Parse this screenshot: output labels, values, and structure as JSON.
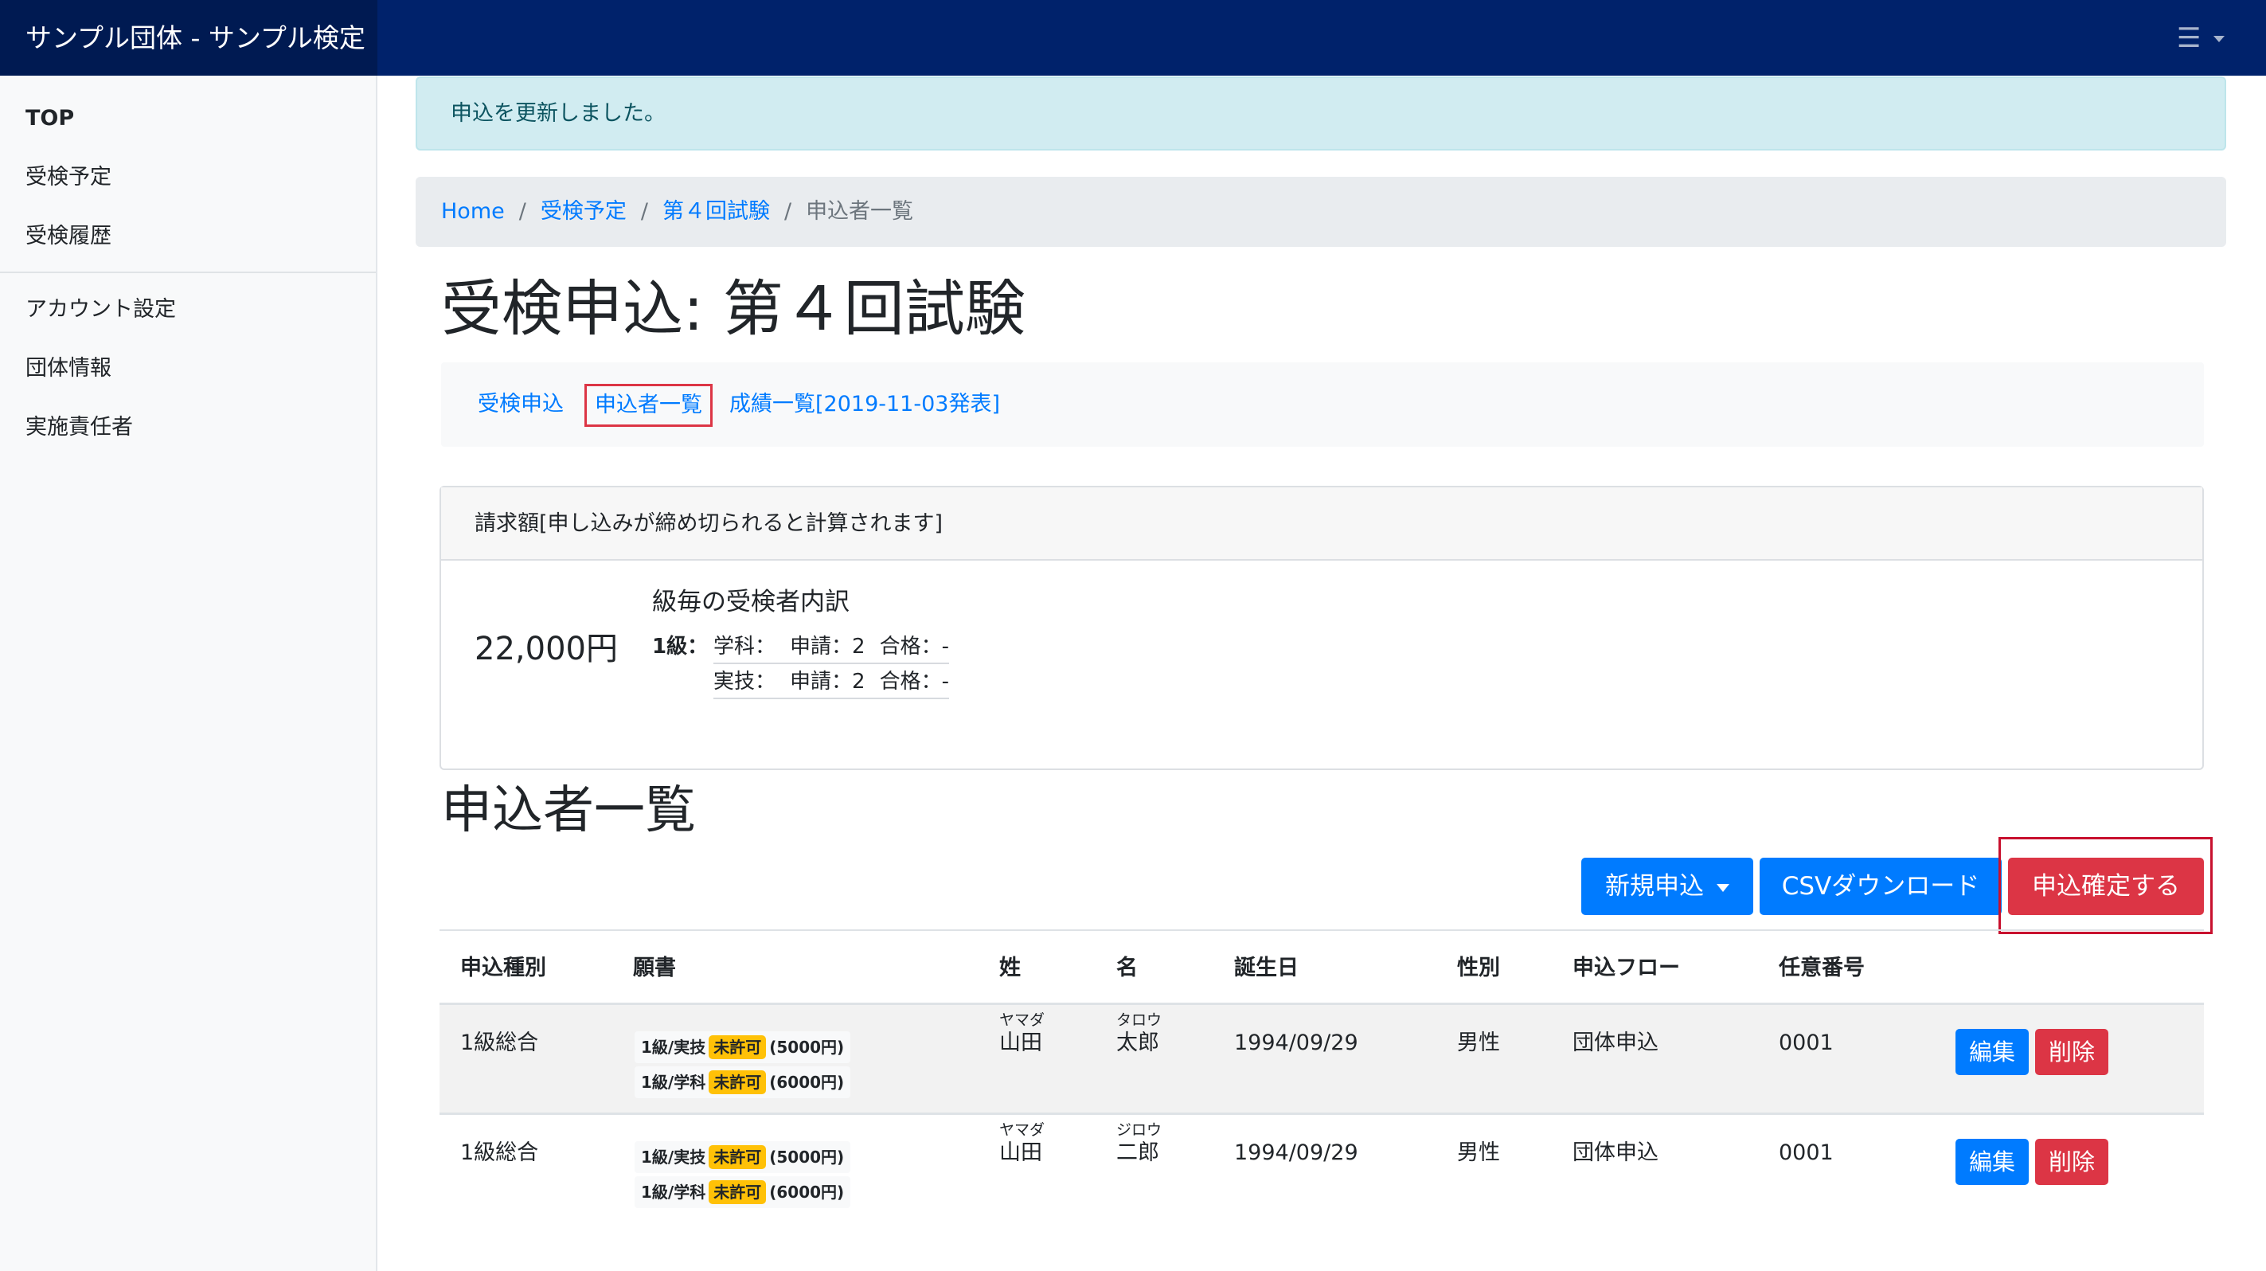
{
  "header": {
    "brand": "サンプル団体 - サンプル検定",
    "menu_icon": "hamburger-icon"
  },
  "sidebar": {
    "items": [
      {
        "label": "TOP"
      },
      {
        "label": "受検予定"
      },
      {
        "label": "受検履歴"
      },
      {
        "label": "アカウント設定"
      },
      {
        "label": "団体情報"
      },
      {
        "label": "実施責任者"
      }
    ]
  },
  "alert": {
    "message": "申込を更新しました。"
  },
  "breadcrumb": {
    "home": "Home",
    "schedule": "受検予定",
    "exam": "第４回試験",
    "current": "申込者一覧",
    "separator": "/"
  },
  "page": {
    "title": "受検申込: 第４回試験"
  },
  "subnav": {
    "apply": "受検申込",
    "applicants": "申込者一覧",
    "results": "成績一覧[2019-11-03発表]"
  },
  "invoice": {
    "header": "請求額[申し込みが締め切られると計算されます]",
    "amount": "22,000円",
    "breakdown_title": "級毎の受検者内訳",
    "grade": "1級：",
    "lines": [
      {
        "subject": "学科：",
        "applied": "申請：2",
        "passed": "合格：-"
      },
      {
        "subject": "実技：",
        "applied": "申請：2",
        "passed": "合格：-"
      }
    ]
  },
  "applicants": {
    "title": "申込者一覧",
    "buttons": {
      "new": "新規申込",
      "csv": "CSVダウンロード",
      "confirm": "申込確定する"
    },
    "columns": [
      "申込種別",
      "願書",
      "姓",
      "名",
      "誕生日",
      "性別",
      "申込フロー",
      "任意番号"
    ],
    "rows": [
      {
        "type": "1級総合",
        "apps": [
          {
            "name": "1級/実技",
            "badge": "未許可",
            "fee": "(5000円)"
          },
          {
            "name": "1級/学科",
            "badge": "未許可",
            "fee": "(6000円)"
          }
        ],
        "last_kana": "ヤマダ",
        "last": "山田",
        "first_kana": "タロウ",
        "first": "太郎",
        "birthday": "1994/09/29",
        "gender": "男性",
        "flow": "団体申込",
        "number": "0001",
        "edit": "編集",
        "delete": "削除"
      },
      {
        "type": "1級総合",
        "apps": [
          {
            "name": "1級/実技",
            "badge": "未許可",
            "fee": "(5000円)"
          },
          {
            "name": "1級/学科",
            "badge": "未許可",
            "fee": "(6000円)"
          }
        ],
        "last_kana": "ヤマダ",
        "last": "山田",
        "first_kana": "ジロウ",
        "first": "二郎",
        "birthday": "1994/09/29",
        "gender": "男性",
        "flow": "団体申込",
        "number": "0001",
        "edit": "編集",
        "delete": "削除"
      }
    ]
  },
  "colors": {
    "navbar": "#00226b",
    "primary": "#007bff",
    "danger": "#dc3545",
    "warning": "#ffc107",
    "alert_bg": "#d1ecf1"
  }
}
